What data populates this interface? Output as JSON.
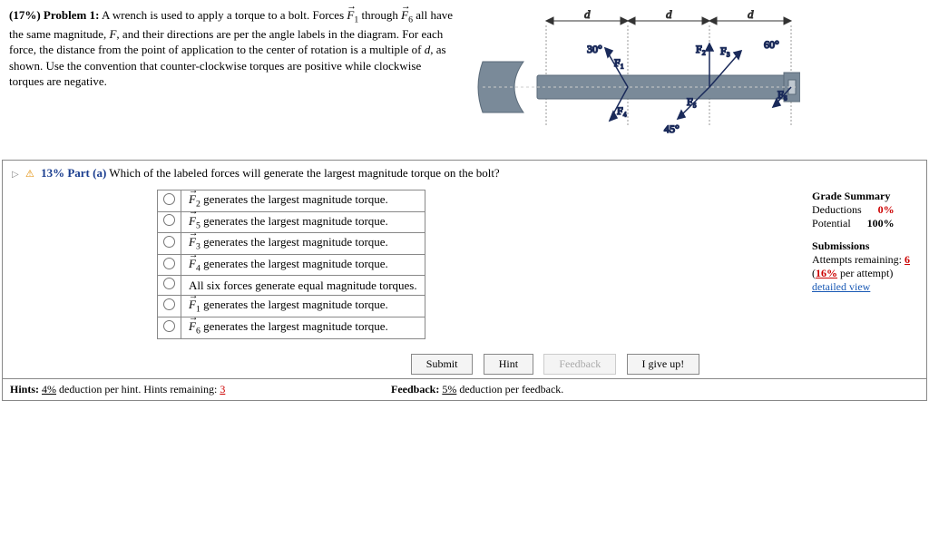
{
  "problem": {
    "percent_label": "(17%)",
    "title": "Problem 1:",
    "text_1": "A wrench is used to apply a torque to a bolt. Forces ",
    "text_2": " through ",
    "text_3": " all have the same magnitude, ",
    "text_4": ", and their directions are per the angle labels in the diagram. For each force, the distance from the point of application to the center of rotation is a multiple of ",
    "text_5": ", as shown. Use the convention that counter-clockwise torques are positive while clockwise torques are negative."
  },
  "part": {
    "percent": "13%",
    "label": "Part (a)",
    "question": "Which of the labeled forces will generate the largest magnitude torque on the bolt?"
  },
  "options": [
    {
      "f": "F",
      "sub": "2",
      "rest": " generates the largest magnitude torque."
    },
    {
      "f": "F",
      "sub": "5",
      "rest": " generates the largest magnitude torque."
    },
    {
      "f": "F",
      "sub": "3",
      "rest": " generates the largest magnitude torque."
    },
    {
      "f": "F",
      "sub": "4",
      "rest": " generates the largest magnitude torque."
    },
    {
      "plain": "All six forces generate equal magnitude torques."
    },
    {
      "f": "F",
      "sub": "1",
      "rest": " generates the largest magnitude torque."
    },
    {
      "f": "F",
      "sub": "6",
      "rest": " generates the largest magnitude torque."
    }
  ],
  "summary": {
    "title": "Grade Summary",
    "deductions_label": "Deductions",
    "deductions_val": "0%",
    "potential_label": "Potential",
    "potential_val": "100%",
    "submissions_title": "Submissions",
    "attempts_label": "Attempts remaining:",
    "attempts_val": "6",
    "per_attempt": "(16% per attempt)",
    "detailed": "detailed view"
  },
  "buttons": {
    "submit": "Submit",
    "hint": "Hint",
    "feedback": "Feedback",
    "giveup": "I give up!"
  },
  "footer": {
    "hints_label": "Hints:",
    "hints_pct": "4%",
    "hints_text": " deduction per hint. Hints remaining: ",
    "hints_remaining": "3",
    "feedback_label": "Feedback:",
    "feedback_pct": "5%",
    "feedback_text": " deduction per feedback."
  },
  "diagram": {
    "d": "d",
    "ang30": "30°",
    "ang45": "45°",
    "ang60": "60°",
    "F1": "F₁",
    "F2": "F₂",
    "F3": "F₃",
    "F4": "F₄",
    "F5": "F₅",
    "F6": "F₆"
  }
}
